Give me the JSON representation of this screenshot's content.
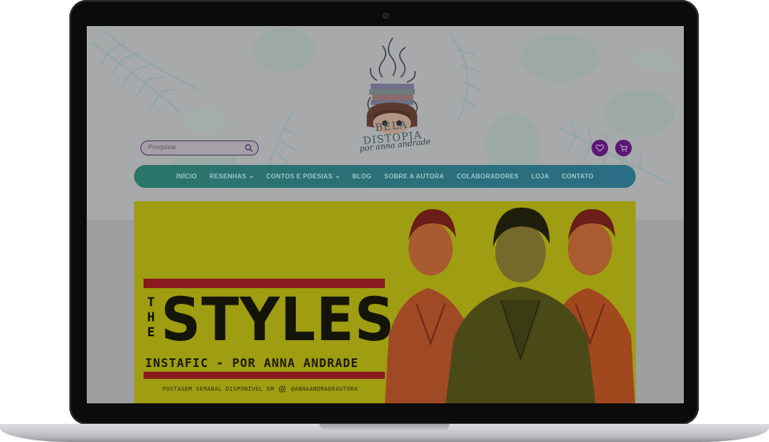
{
  "site": {
    "logo_title": "BELA DISTOPIA",
    "logo_subtitle": "por anna andrade"
  },
  "search": {
    "placeholder": "Pesquisar",
    "icon": "search-icon"
  },
  "header_buttons": [
    {
      "icon": "heart-icon"
    },
    {
      "icon": "cart-icon"
    }
  ],
  "nav": {
    "items": [
      {
        "label": "INÍCIO",
        "has_dropdown": false
      },
      {
        "label": "RESENHAS",
        "has_dropdown": true
      },
      {
        "label": "CONTOS E POESIAS",
        "has_dropdown": true
      },
      {
        "label": "BLOG",
        "has_dropdown": false
      },
      {
        "label": "SOBRE A AUTORA",
        "has_dropdown": false
      },
      {
        "label": "COLABORADORES",
        "has_dropdown": false
      },
      {
        "label": "LOJA",
        "has_dropdown": false
      },
      {
        "label": "CONTATO",
        "has_dropdown": false
      }
    ]
  },
  "banner": {
    "the": "THE",
    "title": "STYLES",
    "subtitle": "INSTAFIC - POR ANNA ANDRADE",
    "post_line": "POSTAGEM SEMANAL DISPONÍVEL EM",
    "handle": "@ANNAANDRADEAUTORA",
    "colors": {
      "background": "#9f9d11",
      "accent_bar": "#8a1a1f",
      "text": "#141408"
    }
  },
  "colors": {
    "nav_gradient_start": "#2b7569",
    "nav_gradient_end": "#2b6e86",
    "button_purple": "#5a1775"
  }
}
